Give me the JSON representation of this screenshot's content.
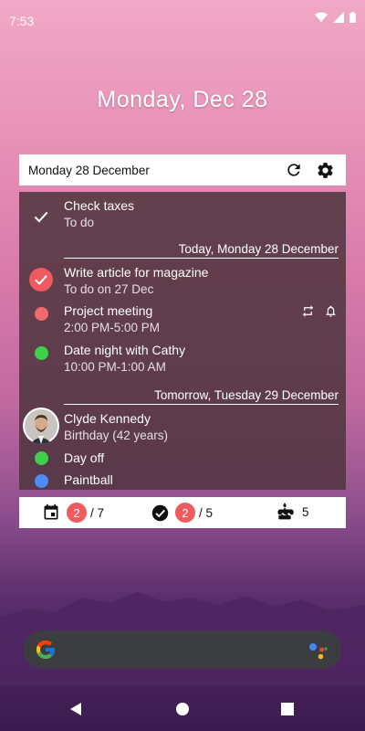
{
  "status": {
    "time": "7:53"
  },
  "clock": {
    "date": "Monday, Dec 28"
  },
  "widget": {
    "header_title": "Monday 28 December",
    "overdue": {
      "title": "Check taxes",
      "subtitle": "To do"
    },
    "today_header": "Today, Monday 28 December",
    "today_items": [
      {
        "title": "Write article for magazine",
        "subtitle": "To do on 27 Dec",
        "color": "#ee5a5e"
      },
      {
        "title": "Project meeting",
        "subtitle": "2:00 PM-5:00 PM",
        "color": "#ef6a6a"
      },
      {
        "title": "Date night with Cathy",
        "subtitle": "10:00 PM-1:00 AM",
        "color": "#3fcf4a"
      }
    ],
    "tomorrow_header": "Tomorrow, Tuesday 29 December",
    "tomorrow_items": [
      {
        "title": "Clyde Kennedy",
        "subtitle": "Birthday (42 years)"
      },
      {
        "title": "Day off",
        "color": "#3fcf4a"
      },
      {
        "title": "Paintball",
        "color": "#4b8df0"
      }
    ],
    "footer": {
      "events_badge": "2",
      "events_total": "/ 7",
      "tasks_badge": "2",
      "tasks_total": "/ 5",
      "birthdays_count": "5"
    }
  }
}
